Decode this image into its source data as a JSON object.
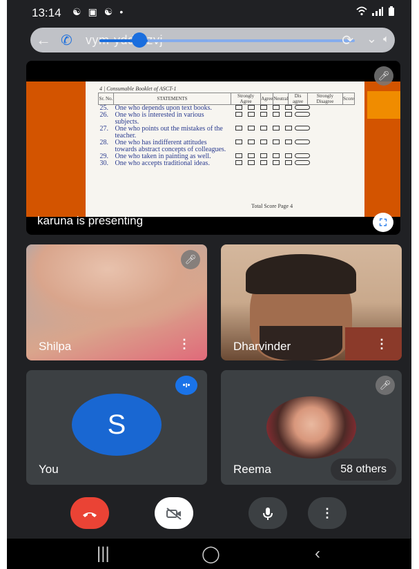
{
  "status_bar": {
    "time": "13:14",
    "left_icons": [
      "☯",
      "▣",
      "☯",
      "•"
    ],
    "right_icons": [
      "wifi-icon",
      "signal-icon",
      "battery-icon"
    ]
  },
  "meeting": {
    "code": "vym-ydda-zvj"
  },
  "presentation": {
    "caption": "karuna is presenting",
    "doc_header": "4 | Consumable Booklet of ASCT-1",
    "columns": [
      "Sr. No.",
      "STATEMENTS",
      "Strongly Agree",
      "Agree",
      "Neutral",
      "Dis agree",
      "Strongly Disagree",
      "Score"
    ],
    "rows": [
      {
        "no": "25.",
        "text": "One who depends upon text books."
      },
      {
        "no": "26.",
        "text": "One who is interested in various subjects."
      },
      {
        "no": "27.",
        "text": "One who points out the mistakes of the teacher."
      },
      {
        "no": "28.",
        "text": "One who has indifferent attitudes towards abstract concepts of colleagues."
      },
      {
        "no": "29.",
        "text": "One who taken in painting as well."
      },
      {
        "no": "30.",
        "text": "One who accepts traditional ideas."
      }
    ],
    "total_label": "Total Score Page 4"
  },
  "participants": [
    {
      "name": "Shilpa"
    },
    {
      "name": "Dharvinder"
    },
    {
      "name": "You",
      "initial": "S"
    },
    {
      "name": "Reema"
    }
  ],
  "others_label": "58 others",
  "colors": {
    "end_call": "#ea4335",
    "accent": "#1a73e8",
    "tile_bg": "#3c4043",
    "app_bg": "#202124"
  }
}
